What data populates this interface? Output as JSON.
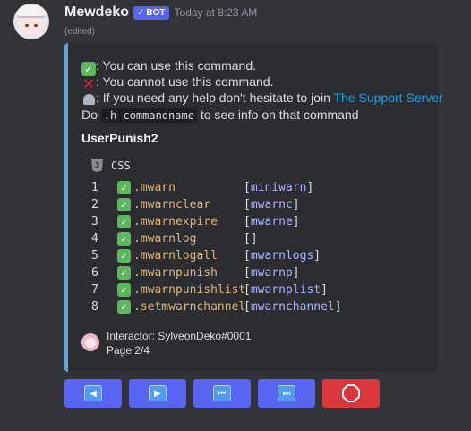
{
  "message": {
    "username": "Mewdeko",
    "bot_badge": "BOT",
    "timestamp": "Today at 8:23 AM",
    "edited": "(edited)"
  },
  "embed": {
    "accent_color": "#5ea6dd",
    "legend": {
      "can_use": ": You can use this command.",
      "cannot_use": ": You cannot use this command.",
      "help_prefix": ": If you need any help don't hesitate to join ",
      "support_link": "The Support Server",
      "info_prefix": "Do ",
      "info_code": ".h commandname",
      "info_suffix": " to see info on that command"
    },
    "module_title": "UserPunish2",
    "code_language": "CSS",
    "commands": [
      {
        "num": "1",
        "name": ".mwarn",
        "alias": "miniwarn"
      },
      {
        "num": "2",
        "name": ".mwarnclear",
        "alias": "mwarnc"
      },
      {
        "num": "3",
        "name": ".mwarnexpire",
        "alias": "mwarne"
      },
      {
        "num": "4",
        "name": ".mwarnlog",
        "alias": ""
      },
      {
        "num": "5",
        "name": ".mwarnlogall",
        "alias": "mwarnlogs"
      },
      {
        "num": "6",
        "name": ".mwarnpunish",
        "alias": "mwarnp"
      },
      {
        "num": "7",
        "name": ".mwarnpunishlist",
        "alias": "mwarnplist"
      },
      {
        "num": "8",
        "name": ".setmwarnchannel",
        "alias": "mwarnchannel"
      }
    ],
    "footer": {
      "interactor": "Interactor: SylveonDeko#0001",
      "page": "Page 2/4"
    }
  },
  "buttons": [
    {
      "name": "previous-button",
      "icon": "previous-icon",
      "glyph": "◀",
      "style": "primary"
    },
    {
      "name": "next-button",
      "icon": "next-icon",
      "glyph": "▶",
      "style": "primary"
    },
    {
      "name": "first-page-button",
      "icon": "first-page-icon",
      "glyph": "⏮",
      "style": "primary"
    },
    {
      "name": "last-page-button",
      "icon": "last-page-icon",
      "glyph": "⏭",
      "style": "primary"
    },
    {
      "name": "stop-button",
      "icon": "stop-icon",
      "glyph": "",
      "style": "danger"
    }
  ]
}
